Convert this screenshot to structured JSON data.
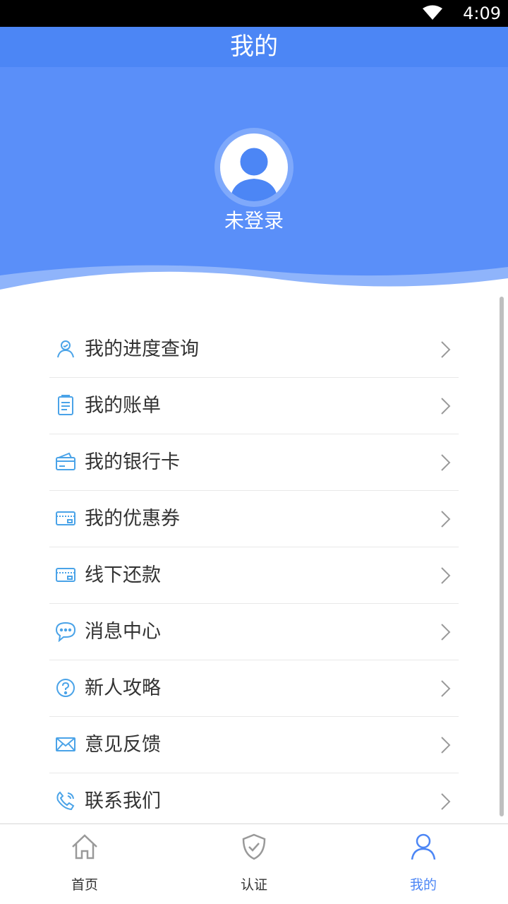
{
  "status_bar": {
    "time": "4:09",
    "icons": [
      "wifi-icon"
    ]
  },
  "header": {
    "title": "我的",
    "login_status": "未登录",
    "avatar_icon": "user-avatar-icon"
  },
  "menu": {
    "items": [
      {
        "label": "我的进度查询",
        "icon": "user-progress-icon"
      },
      {
        "label": "我的账单",
        "icon": "bill-icon"
      },
      {
        "label": "我的银行卡",
        "icon": "bank-card-icon"
      },
      {
        "label": "我的优惠券",
        "icon": "coupon-icon"
      },
      {
        "label": "线下还款",
        "icon": "card-icon"
      },
      {
        "label": "消息中心",
        "icon": "chat-icon"
      },
      {
        "label": "新人攻略",
        "icon": "question-icon"
      },
      {
        "label": "意见反馈",
        "icon": "mail-icon"
      },
      {
        "label": "联系我们",
        "icon": "phone-icon"
      }
    ]
  },
  "bottom_nav": {
    "items": [
      {
        "label": "首页",
        "icon": "home-icon",
        "active": false
      },
      {
        "label": "认证",
        "icon": "shield-check-icon",
        "active": false
      },
      {
        "label": "我的",
        "icon": "user-icon",
        "active": true
      }
    ]
  },
  "colors": {
    "primary": "#4c86f5",
    "header_bg": "#5a8ff9",
    "icon_blue": "#4aa3e8",
    "text": "#333333"
  }
}
